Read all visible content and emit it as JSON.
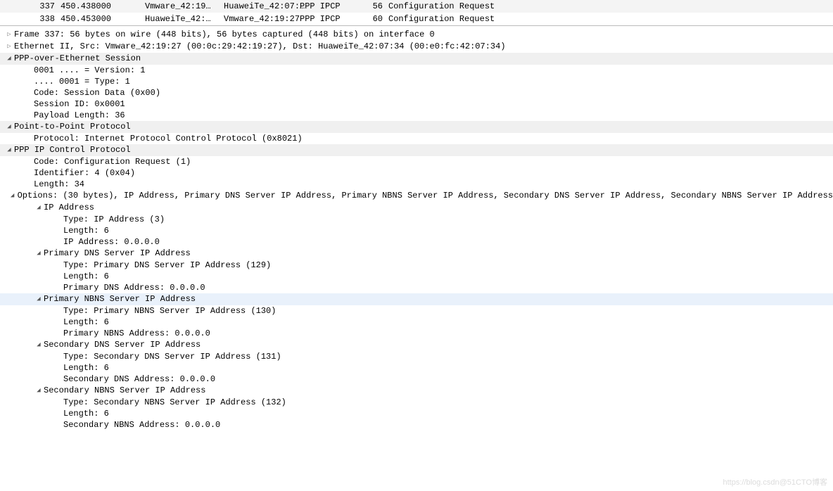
{
  "packetList": [
    {
      "no": "337",
      "time": "450.438000",
      "src": "Vmware_42:19…",
      "dst": "HuaweiTe_42:07:…",
      "proto": "PPP IPCP",
      "len": "56",
      "info": "Configuration Request",
      "selected": true
    },
    {
      "no": "338",
      "time": "450.453000",
      "src": "HuaweiTe_42:…",
      "dst": "Vmware_42:19:27",
      "proto": "PPP IPCP",
      "len": "60",
      "info": "Configuration Request",
      "selected": false
    }
  ],
  "details": [
    {
      "indent": 0,
      "tw": "closed",
      "hdr": false,
      "sel": false,
      "text": "Frame 337: 56 bytes on wire (448 bits), 56 bytes captured (448 bits) on interface 0"
    },
    {
      "indent": 0,
      "tw": "closed",
      "hdr": false,
      "sel": false,
      "text": "Ethernet II, Src: Vmware_42:19:27 (00:0c:29:42:19:27), Dst: HuaweiTe_42:07:34 (00:e0:fc:42:07:34)"
    },
    {
      "indent": 0,
      "tw": "open",
      "hdr": true,
      "sel": false,
      "text": "PPP-over-Ethernet Session"
    },
    {
      "indent": 2,
      "tw": "none",
      "hdr": false,
      "sel": false,
      "text": "0001 .... = Version: 1"
    },
    {
      "indent": 2,
      "tw": "none",
      "hdr": false,
      "sel": false,
      "text": ".... 0001 = Type: 1"
    },
    {
      "indent": 2,
      "tw": "none",
      "hdr": false,
      "sel": false,
      "text": "Code: Session Data (0x00)"
    },
    {
      "indent": 2,
      "tw": "none",
      "hdr": false,
      "sel": false,
      "text": "Session ID: 0x0001"
    },
    {
      "indent": 2,
      "tw": "none",
      "hdr": false,
      "sel": false,
      "text": "Payload Length: 36"
    },
    {
      "indent": 0,
      "tw": "open",
      "hdr": true,
      "sel": false,
      "text": "Point-to-Point Protocol"
    },
    {
      "indent": 2,
      "tw": "none",
      "hdr": false,
      "sel": false,
      "text": "Protocol: Internet Protocol Control Protocol (0x8021)"
    },
    {
      "indent": 0,
      "tw": "open",
      "hdr": true,
      "sel": false,
      "text": "PPP IP Control Protocol"
    },
    {
      "indent": 2,
      "tw": "none",
      "hdr": false,
      "sel": false,
      "text": "Code: Configuration Request (1)"
    },
    {
      "indent": 2,
      "tw": "none",
      "hdr": false,
      "sel": false,
      "text": "Identifier: 4 (0x04)"
    },
    {
      "indent": 2,
      "tw": "none",
      "hdr": false,
      "sel": false,
      "text": "Length: 34"
    },
    {
      "indent": 1,
      "tw": "open",
      "hdr": false,
      "sel": false,
      "text": "Options: (30 bytes), IP Address, Primary DNS Server IP Address, Primary NBNS Server IP Address, Secondary DNS Server IP Address, Secondary NBNS Server IP Address"
    },
    {
      "indent": 3,
      "tw": "open",
      "hdr": false,
      "sel": false,
      "text": "IP Address"
    },
    {
      "indent": 5,
      "tw": "none",
      "hdr": false,
      "sel": false,
      "text": "Type: IP Address (3)"
    },
    {
      "indent": 5,
      "tw": "none",
      "hdr": false,
      "sel": false,
      "text": "Length: 6"
    },
    {
      "indent": 5,
      "tw": "none",
      "hdr": false,
      "sel": false,
      "text": "IP Address: 0.0.0.0"
    },
    {
      "indent": 3,
      "tw": "open",
      "hdr": false,
      "sel": false,
      "text": "Primary DNS Server IP Address"
    },
    {
      "indent": 5,
      "tw": "none",
      "hdr": false,
      "sel": false,
      "text": "Type: Primary DNS Server IP Address (129)"
    },
    {
      "indent": 5,
      "tw": "none",
      "hdr": false,
      "sel": false,
      "text": "Length: 6"
    },
    {
      "indent": 5,
      "tw": "none",
      "hdr": false,
      "sel": false,
      "text": "Primary DNS Address: 0.0.0.0"
    },
    {
      "indent": 3,
      "tw": "open",
      "hdr": false,
      "sel": true,
      "text": "Primary NBNS Server IP Address"
    },
    {
      "indent": 5,
      "tw": "none",
      "hdr": false,
      "sel": false,
      "text": "Type: Primary NBNS Server IP Address (130)"
    },
    {
      "indent": 5,
      "tw": "none",
      "hdr": false,
      "sel": false,
      "text": "Length: 6"
    },
    {
      "indent": 5,
      "tw": "none",
      "hdr": false,
      "sel": false,
      "text": "Primary NBNS Address: 0.0.0.0"
    },
    {
      "indent": 3,
      "tw": "open",
      "hdr": false,
      "sel": false,
      "text": "Secondary DNS Server IP Address"
    },
    {
      "indent": 5,
      "tw": "none",
      "hdr": false,
      "sel": false,
      "text": "Type: Secondary DNS Server IP Address (131)"
    },
    {
      "indent": 5,
      "tw": "none",
      "hdr": false,
      "sel": false,
      "text": "Length: 6"
    },
    {
      "indent": 5,
      "tw": "none",
      "hdr": false,
      "sel": false,
      "text": "Secondary DNS Address: 0.0.0.0"
    },
    {
      "indent": 3,
      "tw": "open",
      "hdr": false,
      "sel": false,
      "text": "Secondary NBNS Server IP Address"
    },
    {
      "indent": 5,
      "tw": "none",
      "hdr": false,
      "sel": false,
      "text": "Type: Secondary NBNS Server IP Address (132)"
    },
    {
      "indent": 5,
      "tw": "none",
      "hdr": false,
      "sel": false,
      "text": "Length: 6"
    },
    {
      "indent": 5,
      "tw": "none",
      "hdr": false,
      "sel": false,
      "text": "Secondary NBNS Address: 0.0.0.0"
    }
  ],
  "watermark": "https://blog.csdn@51CTO博客"
}
